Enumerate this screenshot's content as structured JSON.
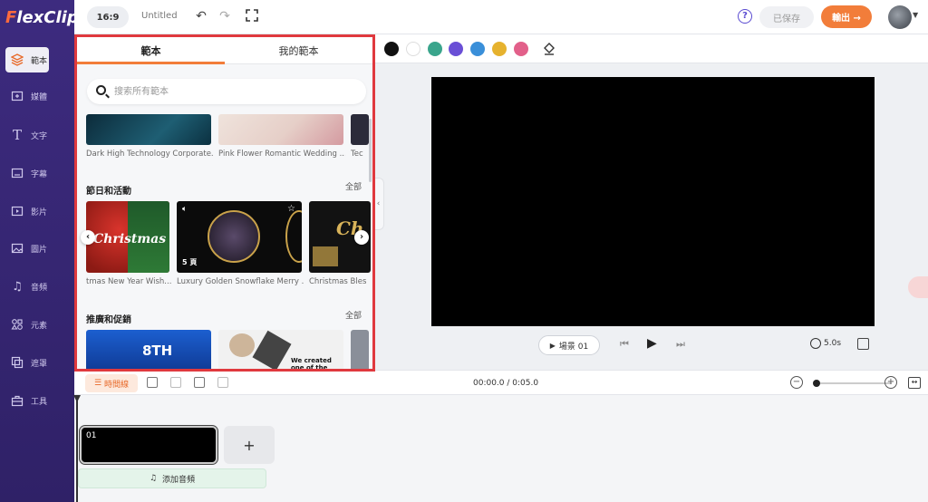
{
  "app": {
    "logo_first": "F",
    "logo_rest": "lexClip"
  },
  "sidebar": {
    "items": [
      {
        "label": "範本",
        "icon": "layers-icon"
      },
      {
        "label": "媒體",
        "icon": "media-icon"
      },
      {
        "label": "文字",
        "icon": "text-icon"
      },
      {
        "label": "字幕",
        "icon": "subtitle-icon"
      },
      {
        "label": "影片",
        "icon": "video-icon"
      },
      {
        "label": "圖片",
        "icon": "image-icon"
      },
      {
        "label": "音頻",
        "icon": "music-icon"
      },
      {
        "label": "元素",
        "icon": "elements-icon"
      },
      {
        "label": "遮罩",
        "icon": "mask-icon"
      },
      {
        "label": "工具",
        "icon": "tools-icon"
      }
    ]
  },
  "topbar": {
    "ratio": "16:9",
    "title": "Untitled",
    "help": "?",
    "saved": "已保存",
    "export": "輸出 →"
  },
  "colors": {
    "accent": "#f27d3a",
    "sidebar": "#3d2b7f",
    "swatches": [
      "#111111",
      "#ffffff",
      "#3aa58c",
      "#6a4fd6",
      "#3a8fd9",
      "#e6b22e",
      "#e2608a"
    ]
  },
  "panel": {
    "tabs": [
      "範本",
      "我的範本"
    ],
    "search_placeholder": "搜索所有範本",
    "top_captions": [
      "Dark High Technology Corporate...",
      "Pink Flower Romantic Wedding ...",
      "Tec"
    ],
    "sections": [
      {
        "title": "節日和活動",
        "see_all": "全部",
        "captions": [
          "tmas New Year Wish...",
          "Luxury Golden Snowflake Merry ...",
          "Christmas Bles"
        ],
        "thumb_badge": "5 頁",
        "thumb_text_1": "Christmas",
        "thumb_text_3": "Ch"
      },
      {
        "title": "推廣和促銷",
        "see_all": "全部",
        "thumb_text_1": "8TH",
        "thumb_text_2": "We created one of the"
      }
    ]
  },
  "preview": {
    "scene_label": "場景 01",
    "duration": "5.0s"
  },
  "timeline": {
    "label": "時間線",
    "time": "00:00.0 / 0:05.0",
    "clip_label": "01",
    "add_scene": "+",
    "add_audio": "添加音頻"
  }
}
